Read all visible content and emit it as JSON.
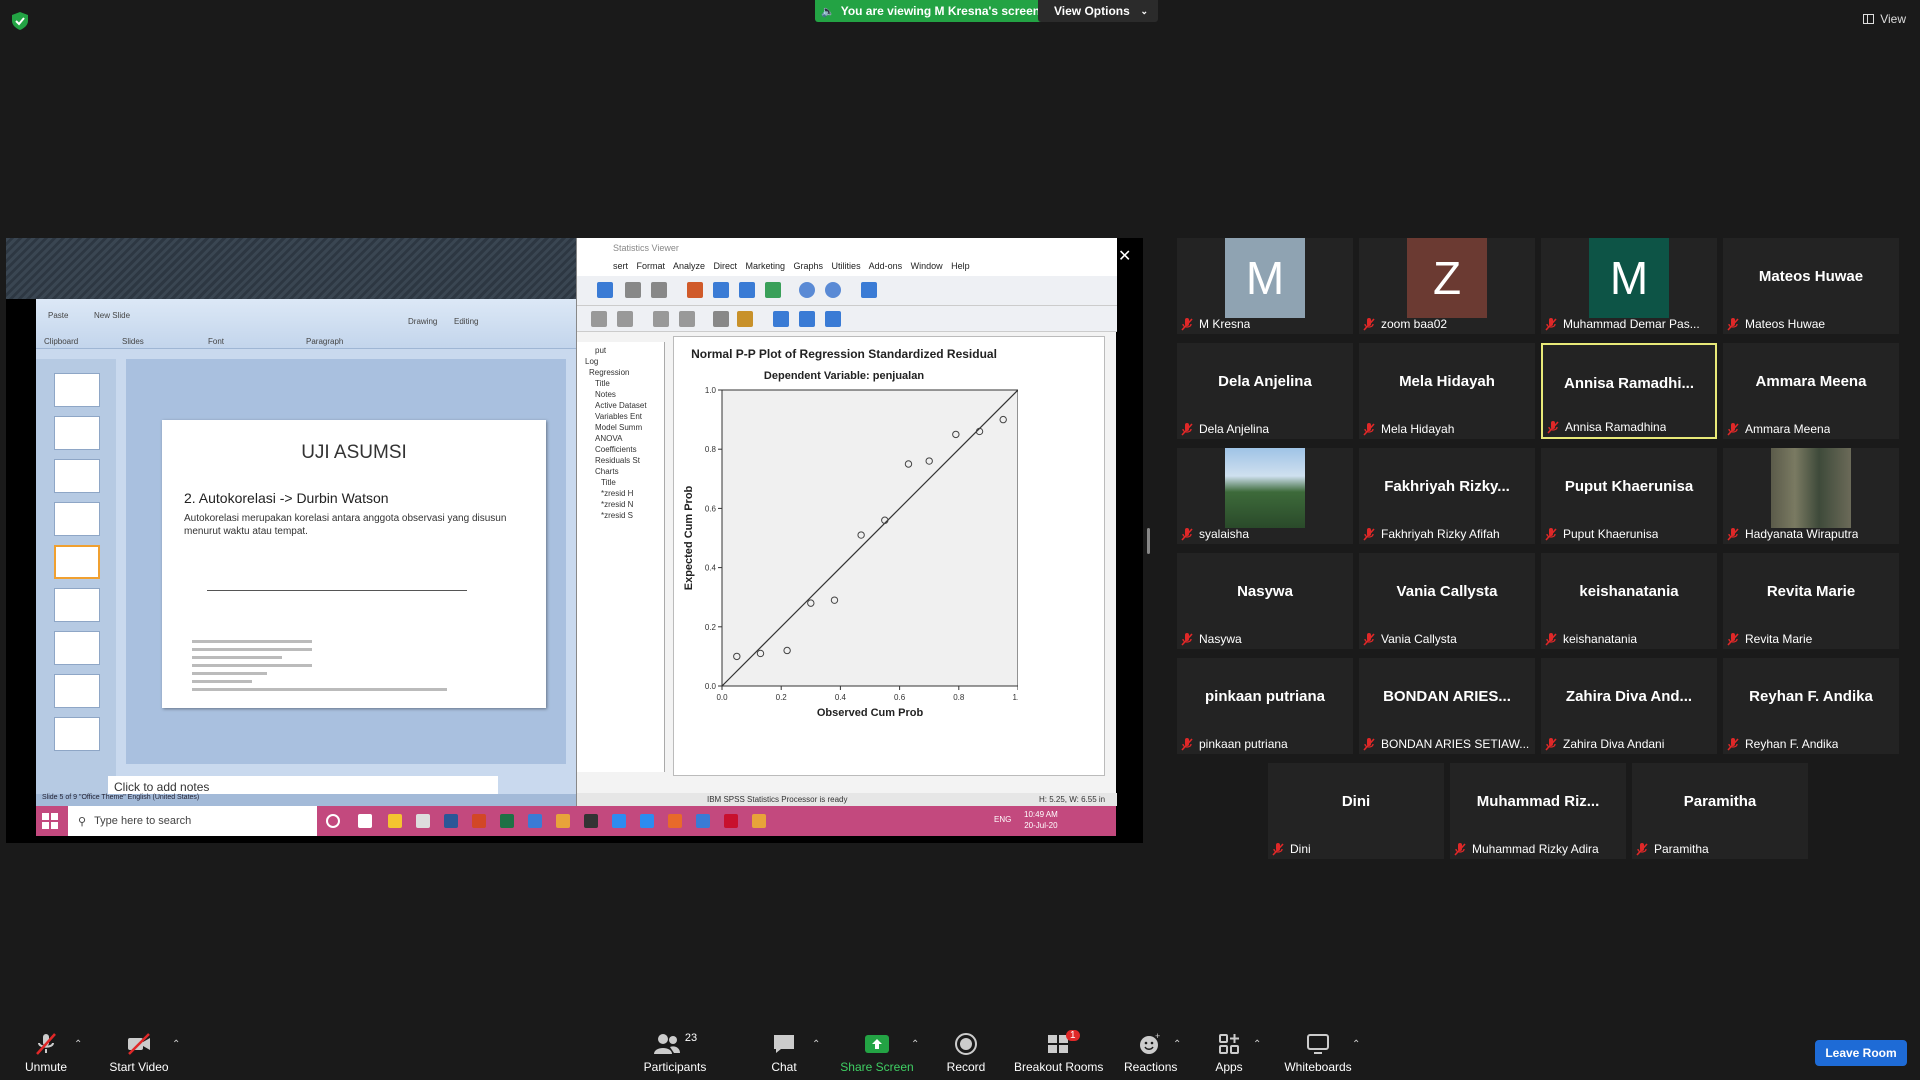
{
  "banner": {
    "text": "You are viewing M Kresna's screen",
    "view_options": "View Options",
    "view": "View"
  },
  "shared": {
    "ppt": {
      "slide_title": "UJI ASUMSI",
      "slide_subtitle": "2. Autokorelasi -> Durbin Watson",
      "slide_text": "Autokorelasi merupakan korelasi antara anggota observasi yang disusun menurut waktu atau tempat.",
      "notes": "Click to add notes",
      "status": "Slide 5 of 9    \"Office Theme\"    English (United States)",
      "labels": {
        "clipboard": "Clipboard",
        "font": "Font",
        "paragraph": "Paragraph",
        "drawing": "Drawing",
        "editing": "Editing",
        "paste": "Paste",
        "new_slide": "New Slide",
        "slides": "Slides"
      }
    },
    "spss": {
      "title": "Statistics Viewer",
      "menu": "sert Format Analyze Direct Marketing Graphs Utilities Add-ons Window Help",
      "tree": [
        "put",
        "Log",
        "Regression",
        "Title",
        "Notes",
        "Active Dataset",
        "Variables Ent",
        "Model Summ",
        "ANOVA",
        "Coefficients",
        "Residuals St",
        "Charts",
        "Title",
        "*zresid H",
        "*zresid N",
        "*zresid S"
      ],
      "status_left": "IBM SPSS Statistics Processor is ready",
      "status_right": "H: 5.25, W: 6.55 in"
    },
    "taskbar": {
      "search": "Type here to search",
      "lang": "ENG",
      "time": "10:49 AM",
      "date": "20-Jul-20"
    }
  },
  "chart_data": {
    "type": "scatter",
    "title": "Normal P-P Plot of Regression Standardized Residual",
    "subtitle": "Dependent Variable: penjualan",
    "xlabel": "Observed Cum Prob",
    "ylabel": "Expected Cum Prob",
    "xlim": [
      0,
      1
    ],
    "ylim": [
      0,
      1
    ],
    "xticks": [
      "0.0",
      "0.2",
      "0.4",
      "0.6",
      "0.8",
      "1.0"
    ],
    "yticks": [
      "0.0",
      "0.2",
      "0.4",
      "0.6",
      "0.8",
      "1.0"
    ],
    "reference_line": [
      [
        0,
        0
      ],
      [
        1,
        1
      ]
    ],
    "points": [
      {
        "x": 0.05,
        "y": 0.1
      },
      {
        "x": 0.13,
        "y": 0.11
      },
      {
        "x": 0.22,
        "y": 0.12
      },
      {
        "x": 0.3,
        "y": 0.28
      },
      {
        "x": 0.38,
        "y": 0.29
      },
      {
        "x": 0.47,
        "y": 0.51
      },
      {
        "x": 0.55,
        "y": 0.56
      },
      {
        "x": 0.63,
        "y": 0.75
      },
      {
        "x": 0.7,
        "y": 0.76
      },
      {
        "x": 0.79,
        "y": 0.85
      },
      {
        "x": 0.87,
        "y": 0.86
      },
      {
        "x": 0.95,
        "y": 0.9
      }
    ]
  },
  "participants": [
    {
      "display": "M",
      "name": "M Kresna",
      "avatar_color": "#8fa3b2"
    },
    {
      "display": "Z",
      "name": "zoom baa02",
      "avatar_color": "#6b3a32"
    },
    {
      "display": "M",
      "name": "Muhammad Demar Pas...",
      "avatar_color": "#0d5446"
    },
    {
      "display": "Mateos Huwae",
      "name": "Mateos Huwae"
    },
    {
      "display": "Dela Anjelina",
      "name": "Dela Anjelina"
    },
    {
      "display": "Mela Hidayah",
      "name": "Mela Hidayah"
    },
    {
      "display": "Annisa  Ramadhi...",
      "name": "Annisa Ramadhina",
      "active": true
    },
    {
      "display": "Ammara Meena",
      "name": "Ammara Meena"
    },
    {
      "display": "",
      "name": "syalaisha",
      "photo": "mountain"
    },
    {
      "display": "Fakhriyah  Rizky...",
      "name": "Fakhriyah Rizky Afifah"
    },
    {
      "display": "Puput Khaerunisa",
      "name": "Puput Khaerunisa"
    },
    {
      "display": "",
      "name": "Hadyanata Wiraputra",
      "photo": "room"
    },
    {
      "display": "Nasywa",
      "name": "Nasywa"
    },
    {
      "display": "Vania Callysta",
      "name": "Vania Callysta"
    },
    {
      "display": "keishanatania",
      "name": "keishanatania"
    },
    {
      "display": "Revita Marie",
      "name": "Revita Marie"
    },
    {
      "display": "pinkaan putriana",
      "name": "pinkaan putriana"
    },
    {
      "display": "BONDAN  ARIES...",
      "name": "BONDAN ARIES SETIAW..."
    },
    {
      "display": "Zahira Diva And...",
      "name": "Zahira Diva Andani"
    },
    {
      "display": "Reyhan F. Andika",
      "name": "Reyhan F. Andika"
    },
    {
      "display": "Dini",
      "name": "Dini"
    },
    {
      "display": "Muhammad  Riz...",
      "name": "Muhammad Rizky Adira"
    },
    {
      "display": "Paramitha",
      "name": "Paramitha"
    }
  ],
  "toolbar": {
    "unmute": "Unmute",
    "start_video": "Start Video",
    "participants": "Participants",
    "participants_count": "23",
    "chat": "Chat",
    "share_screen": "Share Screen",
    "record": "Record",
    "breakout_rooms": "Breakout Rooms",
    "breakout_badge": "1",
    "reactions": "Reactions",
    "apps": "Apps",
    "whiteboards": "Whiteboards",
    "leave": "Leave Room"
  },
  "colors": {
    "share_green": "#23a344",
    "leave_blue": "#1e6bd6",
    "active_border": "#e8e978",
    "mute_red": "#e02828",
    "taskbar_pink": "#c3497e"
  }
}
